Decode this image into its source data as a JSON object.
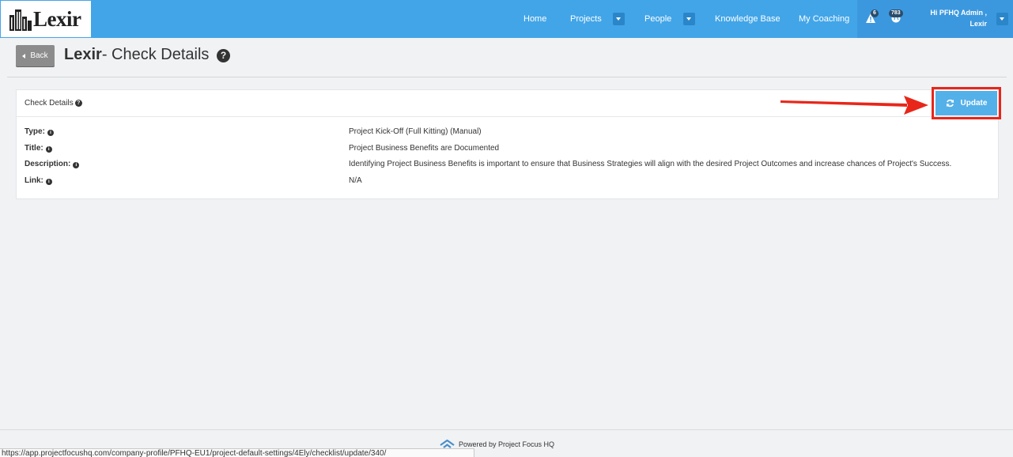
{
  "brand": {
    "name": "Lexir"
  },
  "nav": {
    "items": [
      {
        "label": "Home"
      },
      {
        "label": "Projects"
      },
      {
        "label": "People"
      },
      {
        "label": "Knowledge Base"
      },
      {
        "label": "My Coaching"
      }
    ],
    "alerts_count": "6",
    "notifications_count": "783",
    "user_greeting": "Hi PFHQ Admin ,",
    "user_company": "Lexir"
  },
  "header": {
    "back_label": "Back",
    "title_brand": "Lexir",
    "title_rest": "- Check Details"
  },
  "panel": {
    "title": "Check Details",
    "update_label": "Update",
    "rows": [
      {
        "label": "Type:",
        "value": "Project Kick-Off (Full Kitting) (Manual)"
      },
      {
        "label": "Title:",
        "value": "Project Business Benefits are Documented"
      },
      {
        "label": "Description:",
        "value": "Identifying Project Business Benefits is important to ensure that Business Strategies will align with the desired Project Outcomes and increase chances of Project's Success."
      },
      {
        "label": "Link:",
        "value": "N/A"
      }
    ]
  },
  "footer": {
    "text": "Powered by Project Focus HQ"
  },
  "status_bar": {
    "url": "https://app.projectfocushq.com/company-profile/PFHQ-EU1/project-default-settings/4Ely/checklist/update/340/"
  },
  "colors": {
    "navbar": "#42a5e8",
    "update_button": "#54b0e8",
    "highlight": "#e8261a"
  }
}
